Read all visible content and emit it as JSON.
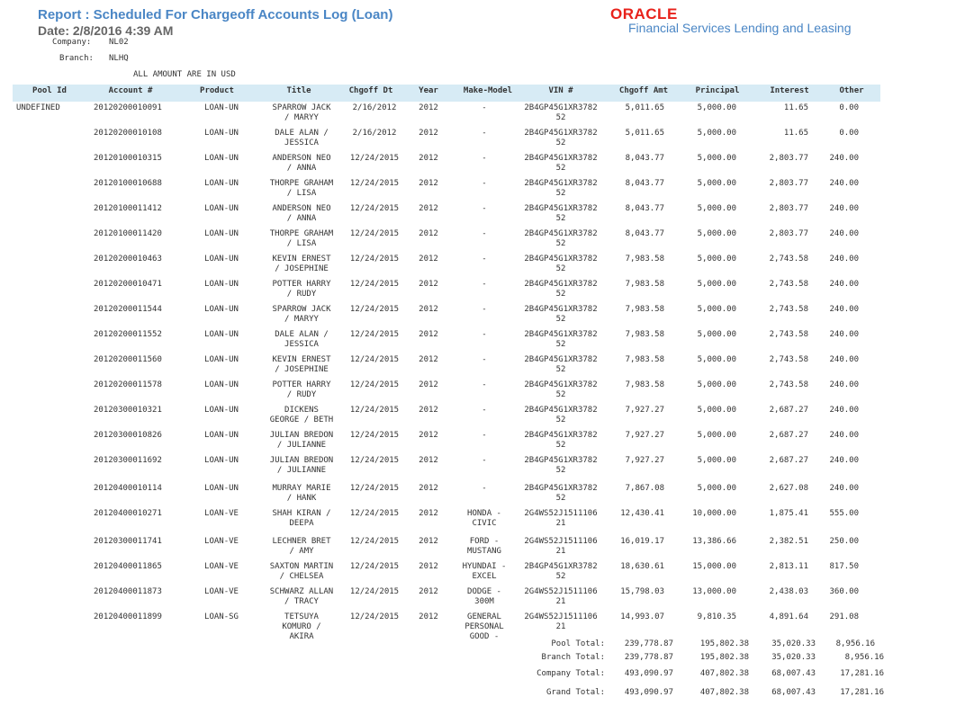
{
  "report": {
    "title": "Report : Scheduled For Chargeoff Accounts Log (Loan)",
    "date": "Date: 2/8/2016  4:39 AM",
    "company_label": "Company:",
    "company_value": "NL02",
    "branch_label": "Branch:",
    "branch_value": "NLHQ",
    "amount_note": "ALL AMOUNT ARE IN  USD"
  },
  "logo": {
    "word": "ORACLE",
    "subtitle": "Financial Services Lending and Leasing"
  },
  "columns": [
    "Pool Id",
    "Account #",
    "Product",
    "Title",
    "Chgoff Dt",
    "Year",
    "Make-Model",
    "VIN #",
    "Chgoff Amt",
    "Principal",
    "Interest",
    "Other"
  ],
  "rows": [
    {
      "pool": "UNDEFINED",
      "account": "20120200010091",
      "product": "LOAN-UN",
      "title": [
        "SPARROW JACK",
        "/ MARYY"
      ],
      "chgoff_dt": "2/16/2012",
      "year": "2012",
      "make_model": [
        "-"
      ],
      "vin": [
        "2B4GP45G1XR3782",
        "52"
      ],
      "amt": "5,011.65",
      "principal": "5,000.00",
      "interest": "11.65",
      "other": "0.00"
    },
    {
      "pool": "",
      "account": "20120200010108",
      "product": "LOAN-UN",
      "title": [
        "DALE ALAN /",
        "JESSICA"
      ],
      "chgoff_dt": "2/16/2012",
      "year": "2012",
      "make_model": [
        "-"
      ],
      "vin": [
        "2B4GP45G1XR3782",
        "52"
      ],
      "amt": "5,011.65",
      "principal": "5,000.00",
      "interest": "11.65",
      "other": "0.00"
    },
    {
      "pool": "",
      "account": "20120100010315",
      "product": "LOAN-UN",
      "title": [
        "ANDERSON NEO",
        "/ ANNA"
      ],
      "chgoff_dt": "12/24/2015",
      "year": "2012",
      "make_model": [
        "-"
      ],
      "vin": [
        "2B4GP45G1XR3782",
        "52"
      ],
      "amt": "8,043.77",
      "principal": "5,000.00",
      "interest": "2,803.77",
      "other": "240.00"
    },
    {
      "pool": "",
      "account": "20120100010688",
      "product": "LOAN-UN",
      "title": [
        "THORPE GRAHAM",
        "/ LISA"
      ],
      "chgoff_dt": "12/24/2015",
      "year": "2012",
      "make_model": [
        "-"
      ],
      "vin": [
        "2B4GP45G1XR3782",
        "52"
      ],
      "amt": "8,043.77",
      "principal": "5,000.00",
      "interest": "2,803.77",
      "other": "240.00"
    },
    {
      "pool": "",
      "account": "20120100011412",
      "product": "LOAN-UN",
      "title": [
        "ANDERSON NEO",
        "/ ANNA"
      ],
      "chgoff_dt": "12/24/2015",
      "year": "2012",
      "make_model": [
        "-"
      ],
      "vin": [
        "2B4GP45G1XR3782",
        "52"
      ],
      "amt": "8,043.77",
      "principal": "5,000.00",
      "interest": "2,803.77",
      "other": "240.00"
    },
    {
      "pool": "",
      "account": "20120100011420",
      "product": "LOAN-UN",
      "title": [
        "THORPE GRAHAM",
        "/ LISA"
      ],
      "chgoff_dt": "12/24/2015",
      "year": "2012",
      "make_model": [
        "-"
      ],
      "vin": [
        "2B4GP45G1XR3782",
        "52"
      ],
      "amt": "8,043.77",
      "principal": "5,000.00",
      "interest": "2,803.77",
      "other": "240.00"
    },
    {
      "pool": "",
      "account": "20120200010463",
      "product": "LOAN-UN",
      "title": [
        "KEVIN ERNEST",
        "/ JOSEPHINE"
      ],
      "chgoff_dt": "12/24/2015",
      "year": "2012",
      "make_model": [
        "-"
      ],
      "vin": [
        "2B4GP45G1XR3782",
        "52"
      ],
      "amt": "7,983.58",
      "principal": "5,000.00",
      "interest": "2,743.58",
      "other": "240.00"
    },
    {
      "pool": "",
      "account": "20120200010471",
      "product": "LOAN-UN",
      "title": [
        "POTTER HARRY",
        "/ RUDY"
      ],
      "chgoff_dt": "12/24/2015",
      "year": "2012",
      "make_model": [
        "-"
      ],
      "vin": [
        "2B4GP45G1XR3782",
        "52"
      ],
      "amt": "7,983.58",
      "principal": "5,000.00",
      "interest": "2,743.58",
      "other": "240.00"
    },
    {
      "pool": "",
      "account": "20120200011544",
      "product": "LOAN-UN",
      "title": [
        "SPARROW JACK",
        "/ MARYY"
      ],
      "chgoff_dt": "12/24/2015",
      "year": "2012",
      "make_model": [
        "-"
      ],
      "vin": [
        "2B4GP45G1XR3782",
        "52"
      ],
      "amt": "7,983.58",
      "principal": "5,000.00",
      "interest": "2,743.58",
      "other": "240.00"
    },
    {
      "pool": "",
      "account": "20120200011552",
      "product": "LOAN-UN",
      "title": [
        "DALE ALAN /",
        "JESSICA"
      ],
      "chgoff_dt": "12/24/2015",
      "year": "2012",
      "make_model": [
        "-"
      ],
      "vin": [
        "2B4GP45G1XR3782",
        "52"
      ],
      "amt": "7,983.58",
      "principal": "5,000.00",
      "interest": "2,743.58",
      "other": "240.00"
    },
    {
      "pool": "",
      "account": "20120200011560",
      "product": "LOAN-UN",
      "title": [
        "KEVIN ERNEST",
        "/ JOSEPHINE"
      ],
      "chgoff_dt": "12/24/2015",
      "year": "2012",
      "make_model": [
        "-"
      ],
      "vin": [
        "2B4GP45G1XR3782",
        "52"
      ],
      "amt": "7,983.58",
      "principal": "5,000.00",
      "interest": "2,743.58",
      "other": "240.00"
    },
    {
      "pool": "",
      "account": "20120200011578",
      "product": "LOAN-UN",
      "title": [
        "POTTER HARRY",
        "/ RUDY"
      ],
      "chgoff_dt": "12/24/2015",
      "year": "2012",
      "make_model": [
        "-"
      ],
      "vin": [
        "2B4GP45G1XR3782",
        "52"
      ],
      "amt": "7,983.58",
      "principal": "5,000.00",
      "interest": "2,743.58",
      "other": "240.00"
    },
    {
      "pool": "",
      "account": "20120300010321",
      "product": "LOAN-UN",
      "title": [
        "DICKENS",
        "GEORGE / BETH"
      ],
      "chgoff_dt": "12/24/2015",
      "year": "2012",
      "make_model": [
        "-"
      ],
      "vin": [
        "2B4GP45G1XR3782",
        "52"
      ],
      "amt": "7,927.27",
      "principal": "5,000.00",
      "interest": "2,687.27",
      "other": "240.00"
    },
    {
      "pool": "",
      "account": "20120300010826",
      "product": "LOAN-UN",
      "title": [
        "JULIAN BREDON",
        "/ JULIANNE"
      ],
      "chgoff_dt": "12/24/2015",
      "year": "2012",
      "make_model": [
        "-"
      ],
      "vin": [
        "2B4GP45G1XR3782",
        "52"
      ],
      "amt": "7,927.27",
      "principal": "5,000.00",
      "interest": "2,687.27",
      "other": "240.00"
    },
    {
      "pool": "",
      "account": "20120300011692",
      "product": "LOAN-UN",
      "title": [
        "JULIAN BREDON",
        "/ JULIANNE"
      ],
      "chgoff_dt": "12/24/2015",
      "year": "2012",
      "make_model": [
        "-"
      ],
      "vin": [
        "2B4GP45G1XR3782",
        "52"
      ],
      "amt": "7,927.27",
      "principal": "5,000.00",
      "interest": "2,687.27",
      "other": "240.00"
    },
    {
      "pool": "",
      "account": "20120400010114",
      "product": "LOAN-UN",
      "title": [
        "MURRAY MARIE",
        "/ HANK"
      ],
      "chgoff_dt": "12/24/2015",
      "year": "2012",
      "make_model": [
        "-"
      ],
      "vin": [
        "2B4GP45G1XR3782",
        "52"
      ],
      "amt": "7,867.08",
      "principal": "5,000.00",
      "interest": "2,627.08",
      "other": "240.00"
    },
    {
      "pool": "",
      "account": "20120400010271",
      "product": "LOAN-VE",
      "title": [
        "SHAH KIRAN  /",
        "DEEPA"
      ],
      "chgoff_dt": "12/24/2015",
      "year": "2012",
      "make_model": [
        "HONDA -",
        "CIVIC"
      ],
      "vin": [
        "2G4WS52J1511106",
        "21"
      ],
      "amt": "12,430.41",
      "principal": "10,000.00",
      "interest": "1,875.41",
      "other": "555.00"
    },
    {
      "pool": "",
      "account": "20120300011741",
      "product": "LOAN-VE",
      "title": [
        "LECHNER BRET",
        "/ AMY"
      ],
      "chgoff_dt": "12/24/2015",
      "year": "2012",
      "make_model": [
        "FORD -",
        "MUSTANG"
      ],
      "vin": [
        "2G4WS52J1511106",
        "21"
      ],
      "amt": "16,019.17",
      "principal": "13,386.66",
      "interest": "2,382.51",
      "other": "250.00"
    },
    {
      "pool": "",
      "account": "20120400011865",
      "product": "LOAN-VE",
      "title": [
        "SAXTON MARTIN",
        "/ CHELSEA"
      ],
      "chgoff_dt": "12/24/2015",
      "year": "2012",
      "make_model": [
        "HYUNDAI -",
        "EXCEL"
      ],
      "vin": [
        "2B4GP45G1XR3782",
        "52"
      ],
      "amt": "18,630.61",
      "principal": "15,000.00",
      "interest": "2,813.11",
      "other": "817.50"
    },
    {
      "pool": "",
      "account": "20120400011873",
      "product": "LOAN-VE",
      "title": [
        "SCHWARZ ALLAN",
        "/ TRACY"
      ],
      "chgoff_dt": "12/24/2015",
      "year": "2012",
      "make_model": [
        "DODGE -",
        "300M"
      ],
      "vin": [
        "2G4WS52J1511106",
        "21"
      ],
      "amt": "15,798.03",
      "principal": "13,000.00",
      "interest": "2,438.03",
      "other": "360.00"
    },
    {
      "pool": "",
      "account": "20120400011899",
      "product": "LOAN-SG",
      "title": [
        "TETSUYA",
        "KOMURO /",
        "AKIRA"
      ],
      "chgoff_dt": "12/24/2015",
      "year": "2012",
      "make_model": [
        "GENERAL",
        "PERSONAL",
        "GOOD -"
      ],
      "vin": [
        "2G4WS52J1511106",
        "21"
      ],
      "amt": "14,993.07",
      "principal": "9,810.35",
      "interest": "4,891.64",
      "other": "291.08"
    }
  ],
  "totals": [
    {
      "label": "Pool Total:",
      "amt": "239,778.87",
      "principal": "195,802.38",
      "interest": "35,020.33",
      "other": "8,956.16"
    },
    {
      "label": "Branch Total:",
      "amt": "239,778.87",
      "principal": "195,802.38",
      "interest": "35,020.33",
      "other": "8,956.16"
    },
    {
      "label": "Company Total:",
      "amt": "493,090.97",
      "principal": "407,802.38",
      "interest": "68,007.43",
      "other": "17,281.16"
    },
    {
      "label": "Grand Total:",
      "amt": "493,090.97",
      "principal": "407,802.38",
      "interest": "68,007.43",
      "other": "17,281.16"
    }
  ]
}
